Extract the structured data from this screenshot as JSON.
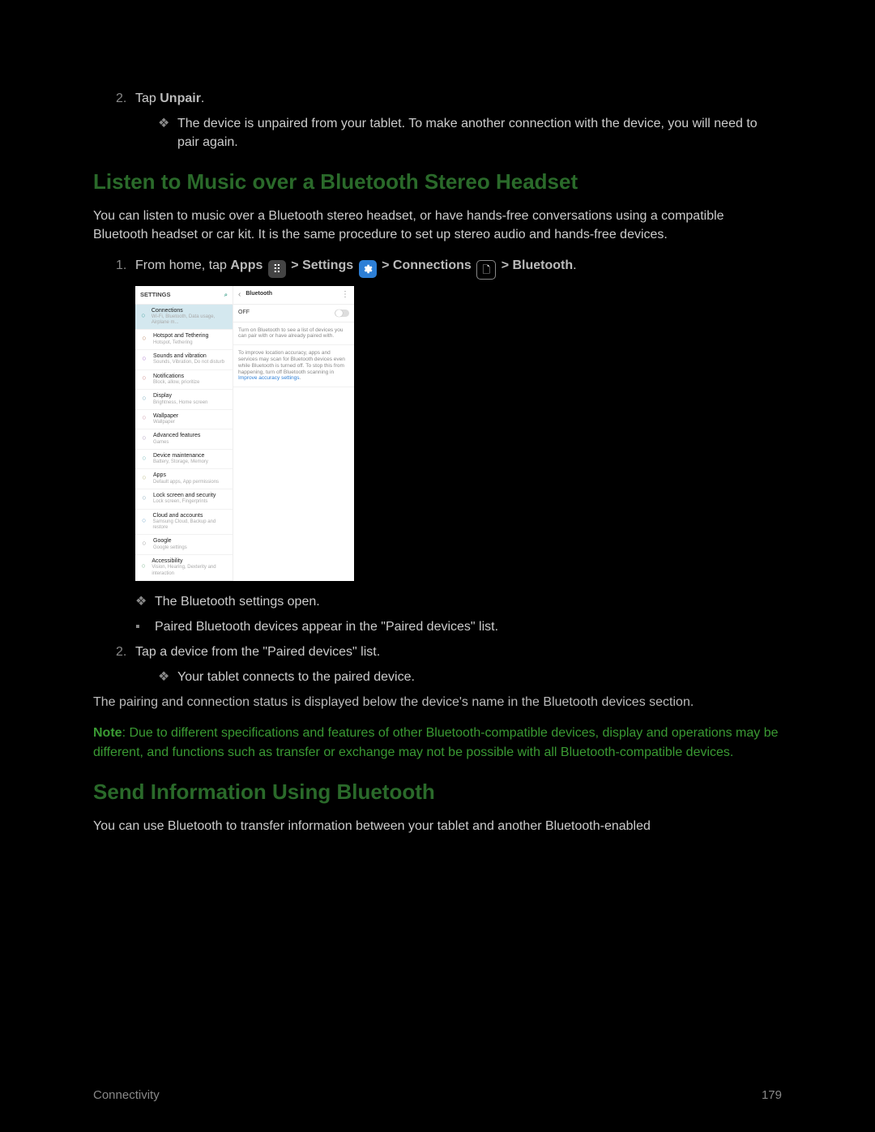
{
  "top_step": {
    "number": "2.",
    "prefix": "Tap ",
    "bold": "Unpair",
    "suffix": "."
  },
  "top_sub": "The device is unpaired from your tablet. To make another connection with the device, you will need to pair again.",
  "heading": "Listen to Music over a Bluetooth Stereo Headset",
  "intro": "You can listen to music over a Bluetooth stereo headset, or have hands-free conversations using a compatible Bluetooth headset or car kit. It is the same procedure to set up stereo audio and hands-free devices.",
  "step1": {
    "number": "1.",
    "p1": "From home, tap ",
    "apps": "Apps",
    "gt1": " > ",
    "settings": "Settings",
    "gt2": " > ",
    "connections": "Connections",
    "gt3": " > ",
    "bluetooth": "Bluetooth",
    "end": "."
  },
  "shot": {
    "left_title": "SETTINGS",
    "items": [
      {
        "title": "Connections",
        "sub": "Wi-Fi, Bluetooth, Data usage, Airplane m..."
      },
      {
        "title": "Hotspot and Tethering",
        "sub": "Hotspot, Tethering"
      },
      {
        "title": "Sounds and vibration",
        "sub": "Sounds, Vibration, Do not disturb"
      },
      {
        "title": "Notifications",
        "sub": "Block, allow, prioritize"
      },
      {
        "title": "Display",
        "sub": "Brightness, Home screen"
      },
      {
        "title": "Wallpaper",
        "sub": "Wallpaper"
      },
      {
        "title": "Advanced features",
        "sub": "Games"
      },
      {
        "title": "Device maintenance",
        "sub": "Battery, Storage, Memory"
      },
      {
        "title": "Apps",
        "sub": "Default apps, App permissions"
      },
      {
        "title": "Lock screen and security",
        "sub": "Lock screen, Fingerprints"
      },
      {
        "title": "Cloud and accounts",
        "sub": "Samsung Cloud, Backup and restore"
      },
      {
        "title": "Google",
        "sub": "Google settings"
      },
      {
        "title": "Accessibility",
        "sub": "Vision, Hearing, Dexterity and interaction"
      }
    ],
    "right_title": "Bluetooth",
    "off": "OFF",
    "info1": "Turn on Bluetooth to see a list of devices you can pair with or have already paired with.",
    "info2a": "To improve location accuracy, apps and services may scan for Bluetooth devices even while Bluetooth is turned off. To stop this from happening, turn off Bluetooth scanning in ",
    "info2link": "Improve accuracy settings",
    "info2b": "."
  },
  "sub1": "The Bluetooth settings open.",
  "sub2_marker": "▪",
  "sub2": "Paired Bluetooth devices appear in the \"Paired devices\" list.",
  "step2": {
    "number": "2.",
    "text": "Tap a device from the \"Paired devices\" list."
  },
  "sub3": "Your tablet connects to the paired device.",
  "para": "The pairing and connection status is displayed below the device's name in the Bluetooth devices section.",
  "note_label": "Note",
  "note_text": ": Due to different specifications and features of other Bluetooth-compatible devices, display and operations may be different, and functions such as transfer or exchange may not be possible with all Bluetooth-compatible devices.",
  "heading2": "Send Information Using Bluetooth",
  "heading2_sub": "You can use Bluetooth to transfer information between your tablet and another Bluetooth-enabled",
  "footer_left": "Connectivity",
  "footer_right": "179"
}
